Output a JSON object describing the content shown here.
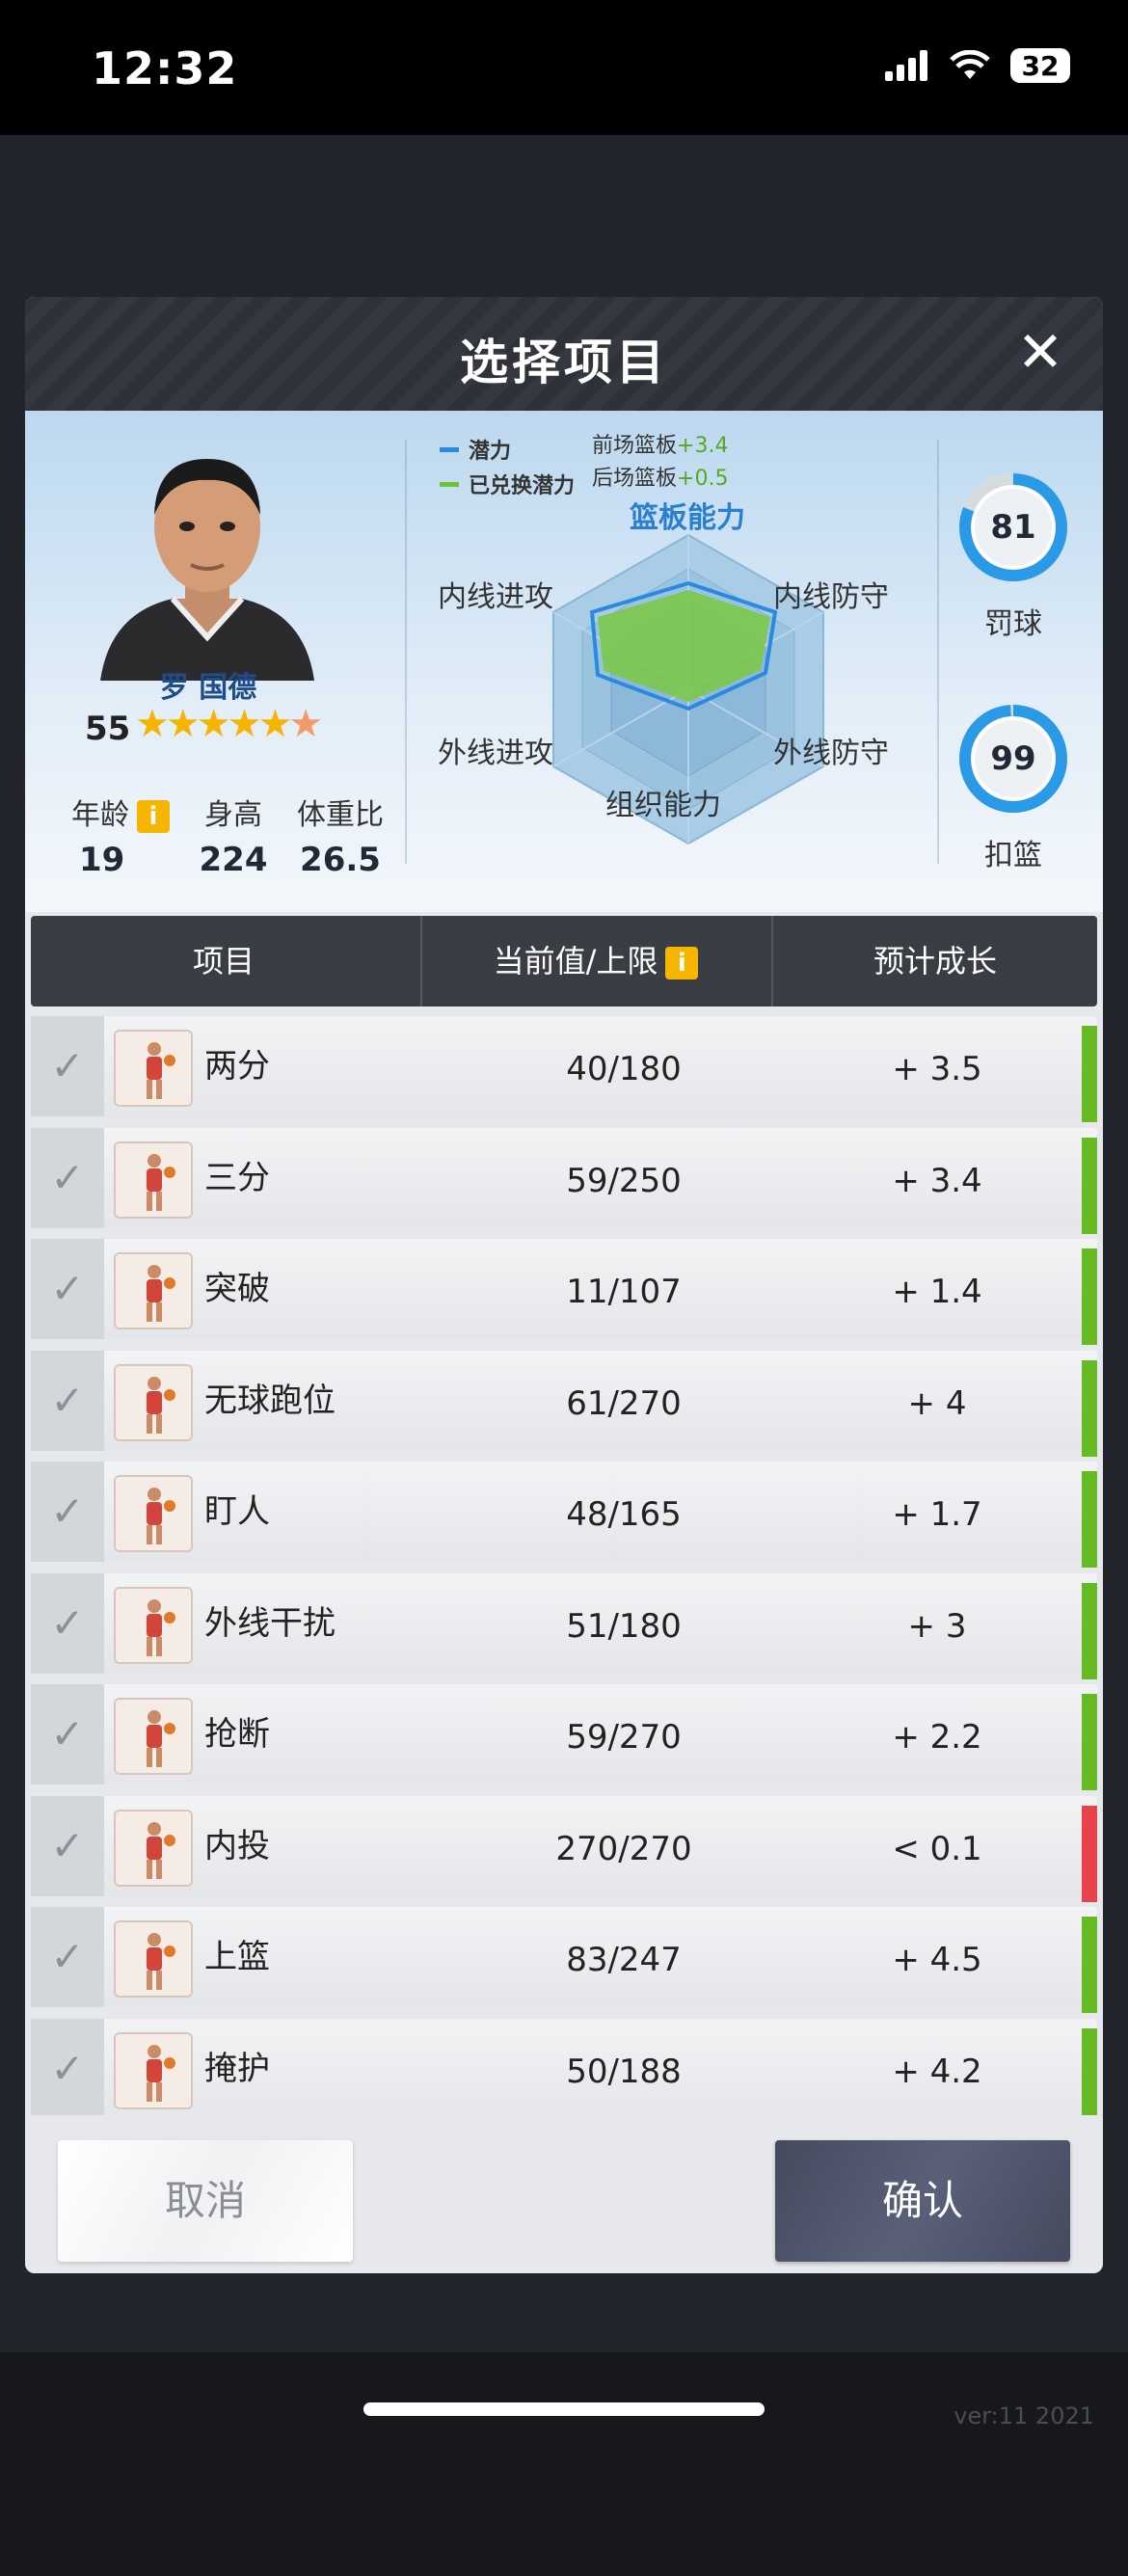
{
  "status_bar": {
    "time": "12:32",
    "battery": "32"
  },
  "modal": {
    "title": "选择项目",
    "close_icon": "close-icon"
  },
  "player": {
    "name": "罗 国德",
    "rating": "55",
    "stars_full": 5,
    "age_label": "年龄",
    "age": "19",
    "height_label": "身高",
    "height": "224",
    "weight_ratio_label": "体重比",
    "weight_ratio": "26.5",
    "info_icon": "i"
  },
  "radar": {
    "legend_potential": "潜力",
    "legend_redeemed": "已兑换潜力",
    "bonus_front_label": "前场篮板",
    "bonus_front_value": "+3.4",
    "bonus_back_label": "后场篮板",
    "bonus_back_value": "+0.5",
    "title": "篮板能力",
    "label_inside_offense": "内线进攻",
    "label_inside_defense": "内线防守",
    "label_outside_offense": "外线进攻",
    "label_outside_defense": "外线防守",
    "label_organize": "组织能力",
    "colors": {
      "potential": "#2a8ae0",
      "redeemed": "#6cc23a"
    }
  },
  "side_stats": {
    "free_throw_value": "81",
    "free_throw_fill": 0.81,
    "free_throw_label": "罚球",
    "dunk_value": "99",
    "dunk_fill": 0.99,
    "dunk_label": "扣篮"
  },
  "table": {
    "col_item": "项目",
    "col_current": "当前值/上限",
    "col_growth": "预计成长",
    "rows": [
      {
        "name": "两分",
        "value": "40/180",
        "growth": "+ 3.5",
        "status": "green"
      },
      {
        "name": "三分",
        "value": "59/250",
        "growth": "+ 3.4",
        "status": "green"
      },
      {
        "name": "突破",
        "value": "11/107",
        "growth": "+ 1.4",
        "status": "green"
      },
      {
        "name": "无球跑位",
        "value": "61/270",
        "growth": "+ 4",
        "status": "green"
      },
      {
        "name": "盯人",
        "value": "48/165",
        "growth": "+ 1.7",
        "status": "green"
      },
      {
        "name": "外线干扰",
        "value": "51/180",
        "growth": "+ 3",
        "status": "green"
      },
      {
        "name": "抢断",
        "value": "59/270",
        "growth": "+ 2.2",
        "status": "green"
      },
      {
        "name": "内投",
        "value": "270/270",
        "growth": "< 0.1",
        "status": "red"
      },
      {
        "name": "上篮",
        "value": "83/247",
        "growth": "+ 4.5",
        "status": "green"
      },
      {
        "name": "掩护",
        "value": "50/188",
        "growth": "+ 4.2",
        "status": "green"
      }
    ],
    "status_colors": {
      "green": "#66bb22",
      "red": "#e8424a"
    }
  },
  "buttons": {
    "cancel": "取消",
    "confirm": "确认"
  },
  "version": "ver:11  2021"
}
